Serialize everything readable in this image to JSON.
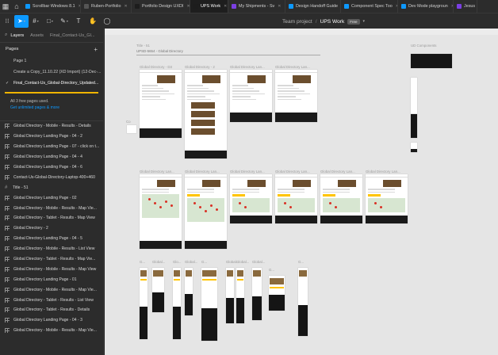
{
  "tabs": [
    {
      "label": "Scrollbar Windows 8.1",
      "color": "#0d99ff",
      "active": false
    },
    {
      "label": "Ruben-Portfolio",
      "color": "#555555",
      "active": false
    },
    {
      "label": "Portfolio Design UXDI",
      "color": "#1d1d1d",
      "active": false
    },
    {
      "label": "UPS Work",
      "color": "#1d1d1d",
      "active": true
    },
    {
      "label": "My Shipments - Sv",
      "color": "#7b3fe4",
      "active": false
    },
    {
      "label": "Design Handoff Guide",
      "color": "#0d99ff",
      "active": false
    },
    {
      "label": "Component Spec Too",
      "color": "#0d99ff",
      "active": false
    },
    {
      "label": "Dev Mode playgroun",
      "color": "#0d99ff",
      "active": false
    },
    {
      "label": "Jesus",
      "color": "#7b3fe4",
      "active": false
    }
  ],
  "toolbar": {
    "project": "Team project",
    "file": "UPS Work",
    "plan_badge": "Free"
  },
  "panel": {
    "tab_layers": "Layers",
    "tab_assets": "Assets",
    "current_page_short": "Final_Contact-Us_Gl..."
  },
  "pages": {
    "header": "Pages",
    "items": [
      {
        "label": "Page 1",
        "current": false
      },
      {
        "label": "Create a Copy_11.10.22 (XD Import) (12-Dec-...",
        "current": false
      },
      {
        "label": "Final_Contact-Us_Global-Directory_Updated...",
        "current": true
      }
    ]
  },
  "notice": {
    "text": "All 3 free pages used.",
    "link": "Get unlimited pages & more"
  },
  "layers": [
    {
      "label": "Global Directory - Mobile - Results - Details",
      "type": "frame"
    },
    {
      "label": "Global Directory Landing Page - 04 - 2",
      "type": "frame"
    },
    {
      "label": "Global Directory Landing Page - 07 - click on t...",
      "type": "frame"
    },
    {
      "label": "Global Directory Landing Page - 04 - 4",
      "type": "frame"
    },
    {
      "label": "Global Directory Landing Page - 04 - 6",
      "type": "frame"
    },
    {
      "label": "Contact-Us-Global-Directory-Laptop-400+460",
      "type": "frame"
    },
    {
      "label": "Title - 51",
      "type": "frame"
    },
    {
      "label": "Global Directory Landing Page - 02",
      "type": "frame"
    },
    {
      "label": "Global Directory - Mobile - Results - Map Vie...",
      "type": "frame"
    },
    {
      "label": "Global Directory - Tablet - Results - Map View",
      "type": "frame"
    },
    {
      "label": "Global Directory - 2",
      "type": "frame"
    },
    {
      "label": "Global Directory Landing Page - 04 - 5",
      "type": "frame"
    },
    {
      "label": "Global Directory - Mobile - Results - List View",
      "type": "frame"
    },
    {
      "label": "Global Directory - Tablet - Results - Map Vie...",
      "type": "frame"
    },
    {
      "label": "Global Directory - Mobile - Results - Map View",
      "type": "frame"
    },
    {
      "label": "Global Directory Landing Page - 01",
      "type": "frame"
    },
    {
      "label": "Global Directory - Mobile - Results - Map Vie...",
      "type": "frame"
    },
    {
      "label": "Global Directory - Tablet - Results - List View",
      "type": "frame"
    },
    {
      "label": "Global Directory - Tablet - Results - Details",
      "type": "frame"
    },
    {
      "label": "Global Directory Landing Page - 04 - 3",
      "type": "frame"
    },
    {
      "label": "Global Directory - Mobile - Results - Map Vie...",
      "type": "frame"
    }
  ],
  "canvas": {
    "section_title": "Title - 51",
    "section_name": "UPSD-5654 - Global Directory",
    "components_label": "UD Components",
    "frame_labels": [
      "Global Directory - D3",
      "Global Directory - 2",
      "Global Directory Lan...",
      "Global Directory Lan..."
    ],
    "row2_labels": [
      "Global Directory Lan...",
      "Global Directory Lan...",
      "Global Directory Lan...",
      "Global Directory Lan...",
      "Global Directory Lan...",
      "Global Directory Lan..."
    ],
    "row3_labels": [
      "G...",
      "Global...",
      "Glo...",
      "Global...",
      "G...",
      "Global...",
      "Global...",
      "Global...",
      "G...",
      "G..."
    ]
  },
  "colors": {
    "accent": "#0d99ff",
    "warning": "#f0b400",
    "ups_yellow": "#ffc400",
    "ups_brown": "#6b4e2e"
  }
}
